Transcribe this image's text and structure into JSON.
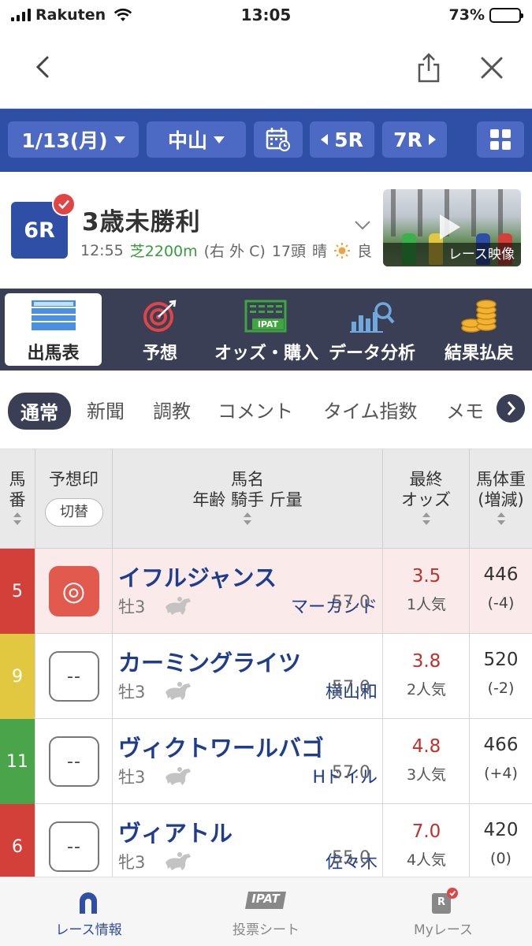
{
  "status": {
    "carrier": "Rakuten",
    "time": "13:05",
    "battery": "73%",
    "battery_level": 0.73
  },
  "toolbar": {
    "date": "1/13(月)",
    "venue": "中山",
    "prev_race": "5R",
    "next_race": "7R"
  },
  "race": {
    "number": "6R",
    "name": "3歳未勝利",
    "time": "12:55",
    "course": "芝2200m",
    "direction": "(右 外 C)",
    "runners": "17頭",
    "weather": "晴",
    "condition": "良",
    "video_label": "レース映像"
  },
  "main_tabs": [
    {
      "label": "出馬表"
    },
    {
      "label": "予想"
    },
    {
      "label": "オッズ・購入"
    },
    {
      "label": "データ分析"
    },
    {
      "label": "結果払戻"
    }
  ],
  "sub_tabs": [
    {
      "label": "通常"
    },
    {
      "label": "新聞"
    },
    {
      "label": "調教"
    },
    {
      "label": "コメント"
    },
    {
      "label": "タイム指数"
    },
    {
      "label": "メモ"
    }
  ],
  "table_header": {
    "number_l1": "馬",
    "number_l2": "番",
    "mark": "予想印",
    "mark_toggle": "切替",
    "horse_l1": "馬名",
    "horse_l2": "年齢 騎手 斤量",
    "odds_l1": "最終",
    "odds_l2": "オッズ",
    "weight_l1": "馬体重",
    "weight_l2": "(増減)"
  },
  "rows": [
    {
      "num": "5",
      "color": "#d3403a",
      "mark": "◎",
      "name": "イフルジャンス",
      "sexage": "牡3",
      "jockey": "マーカンド",
      "weight": "57.0",
      "odds": "3.5",
      "pop": "1人気",
      "bw": "446",
      "bwd": "(-4)"
    },
    {
      "num": "9",
      "color": "#e2c840",
      "mark": "--",
      "name": "カーミングライツ",
      "sexage": "牡3",
      "jockey": "横山和",
      "weight": "57.0",
      "odds": "3.8",
      "pop": "2人気",
      "bw": "520",
      "bwd": "(-2)"
    },
    {
      "num": "11",
      "color": "#4aa54a",
      "mark": "--",
      "name": "ヴィクトワールバゴ",
      "sexage": "牡3",
      "jockey": "Hドイル",
      "weight": "57.0",
      "odds": "4.8",
      "pop": "3人気",
      "bw": "466",
      "bwd": "(+4)"
    },
    {
      "num": "6",
      "color": "#d3403a",
      "mark": "--",
      "name": "ヴィアトル",
      "sexage": "牝3",
      "jockey": "佐々木",
      "weight": "55.0",
      "odds": "7.0",
      "pop": "4人気",
      "bw": "420",
      "bwd": "(0)"
    }
  ],
  "bottom_tabs": [
    {
      "label": "レース情報"
    },
    {
      "label": "投票シート",
      "badge": "IPAT"
    },
    {
      "label": "Myレース",
      "badge": "R"
    }
  ]
}
